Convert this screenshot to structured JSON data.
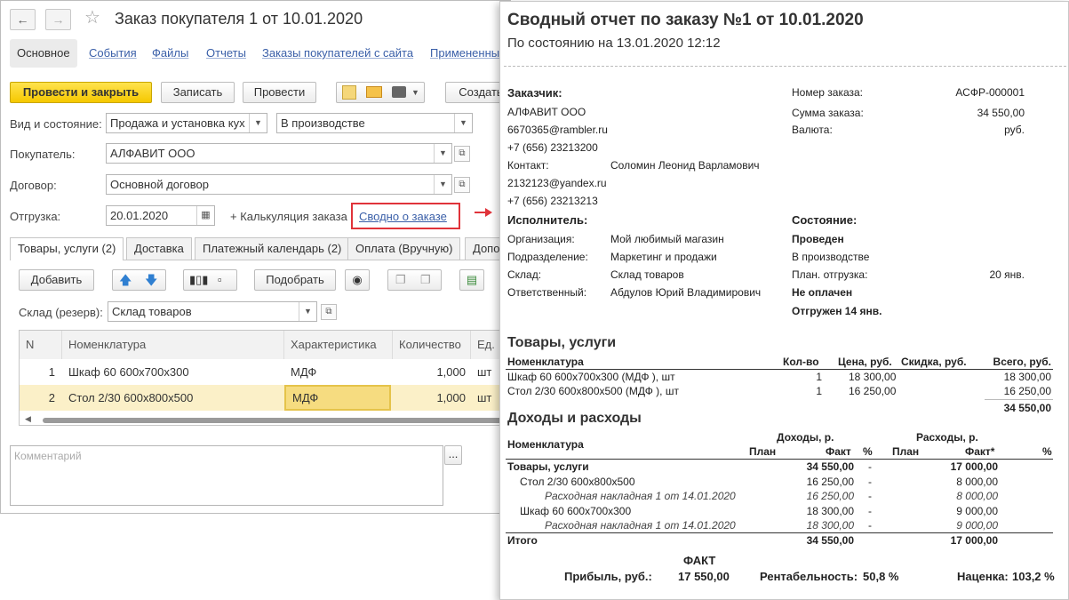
{
  "window": {
    "title": "Заказ покупателя 1 от 10.01.2020",
    "back_icon": "arrow-left-icon",
    "forward_icon": "arrow-right-icon",
    "star_icon": "star-icon",
    "tabs": [
      "Основное",
      "События",
      "Файлы",
      "Отчеты",
      "Заказы покупателей с сайта",
      "Примененные"
    ]
  },
  "toolbar": {
    "post_close": "Провести и закрыть",
    "save": "Записать",
    "post": "Провести",
    "create": "Создать"
  },
  "form": {
    "kind_label": "Вид и состояние:",
    "kind_value": "Продажа и установка кух",
    "state_value": "В производстве",
    "buyer_label": "Покупатель:",
    "buyer_value": "АЛФАВИТ ООО",
    "contract_label": "Договор:",
    "contract_value": "Основной договор",
    "shipment_label": "Отгрузка:",
    "shipment_value": "20.01.2020",
    "calc_label": "+ Калькуляция заказа",
    "summary_link": "Сводно о заказе"
  },
  "inner_tabs": [
    "Товары, услуги (2)",
    "Доставка",
    "Платежный календарь (2)",
    "Оплата (Вручную)",
    "Допо"
  ],
  "table_toolbar": {
    "add": "Добавить",
    "pick": "Подобрать",
    "warehouse_label": "Склад (резерв):",
    "warehouse_value": "Склад товаров"
  },
  "table": {
    "headers": [
      "N",
      "Номенклатура",
      "Характеристика",
      "Количество",
      "Ед."
    ],
    "rows": [
      {
        "n": "1",
        "name": "Шкаф 60 600х700х300",
        "char": "МДФ",
        "qty": "1,000",
        "unit": "шт"
      },
      {
        "n": "2",
        "name": "Стол 2/30 600х800х500",
        "char": "МДФ",
        "qty": "1,000",
        "unit": "шт"
      }
    ]
  },
  "comment": {
    "placeholder": "Комментарий",
    "button": "..."
  },
  "report": {
    "title": "Сводный отчет по заказу №1 от 10.01.2020",
    "subtitle": "По состоянию на 13.01.2020 12:12",
    "customer_head": "Заказчик:",
    "customer_name": "АЛФАВИТ ООО",
    "customer_email": "6670365@rambler.ru",
    "customer_phone": "+7 (656) 23213200",
    "contact_label": "Контакт:",
    "contact_name": "Соломин Леонид Варламович",
    "contact_email": "2132123@yandex.ru",
    "contact_phone": "+7 (656) 23213213",
    "order_no_label": "Номер заказа:",
    "order_no": "АСФР-000001",
    "order_sum_label": "Сумма заказа:",
    "order_sum": "34 550,00",
    "currency_label": "Валюта:",
    "currency": "руб.",
    "executor_head": "Исполнитель:",
    "org_label": "Организация:",
    "org": "Мой любимый магазин",
    "dept_label": "Подразделение:",
    "dept": "Маркетинг и продажи",
    "wh_label": "Склад:",
    "wh": "Склад товаров",
    "resp_label": "Ответственный:",
    "resp": "Абдулов Юрий Владимирович",
    "state_head": "Состояние:",
    "state_posted": "Проведен",
    "state_prod": "В производстве",
    "plan_ship_label": "План. отгрузка:",
    "plan_ship": "20 янв.",
    "not_paid": "Не оплачен",
    "shipped": "Отгружен 14 янв.",
    "goods_head": "Товары, услуги",
    "goods_cols": [
      "Номенклатура",
      "Кол-во",
      "Цена, руб.",
      "Скидка, руб.",
      "Всего, руб."
    ],
    "goods_rows": [
      {
        "name": "Шкаф 60 600х700х300 (МДФ ), шт",
        "qty": "1",
        "price": "18 300,00",
        "total": "18 300,00"
      },
      {
        "name": "Стол 2/30 600х800х500 (МДФ ), шт",
        "qty": "1",
        "price": "16 250,00",
        "total": "16 250,00"
      }
    ],
    "goods_total": "34 550,00",
    "ie_head": "Доходы и расходы",
    "ie_col_name": "Номенклатура",
    "ie_income": "Доходы, р.",
    "ie_expense": "Расходы, р.",
    "ie_plan": "План",
    "ie_fact": "Факт",
    "ie_fact_star": "Факт*",
    "ie_pct": "%",
    "ie_rows": [
      {
        "name": "Товары, услуги",
        "inc": "34 550,00",
        "dash": "-",
        "exp": "17 000,00",
        "style": "bold"
      },
      {
        "name": "Стол 2/30 600х800х500",
        "inc": "16 250,00",
        "dash": "-",
        "exp": "8 000,00",
        "style": "normal"
      },
      {
        "name": "Расходная накладная 1 от 14.01.2020",
        "inc": "16 250,00",
        "dash": "-",
        "exp": "8 000,00",
        "style": "italic"
      },
      {
        "name": "Шкаф 60 600х700х300",
        "inc": "18 300,00",
        "dash": "-",
        "exp": "9 000,00",
        "style": "normal"
      },
      {
        "name": "Расходная накладная 1 от 14.01.2020",
        "inc": "18 300,00",
        "dash": "-",
        "exp": "9 000,00",
        "style": "italic"
      },
      {
        "name": "Итого",
        "inc": "34 550,00",
        "dash": "",
        "exp": "17 000,00",
        "style": "bold"
      }
    ],
    "fact_head": "ФАКТ",
    "profit_label": "Прибыль, руб.:",
    "profit": "17 550,00",
    "rent_label": "Рентабельность:",
    "rent": "50,8 %",
    "markup_label": "Наценка:",
    "markup": "103,2 %"
  }
}
